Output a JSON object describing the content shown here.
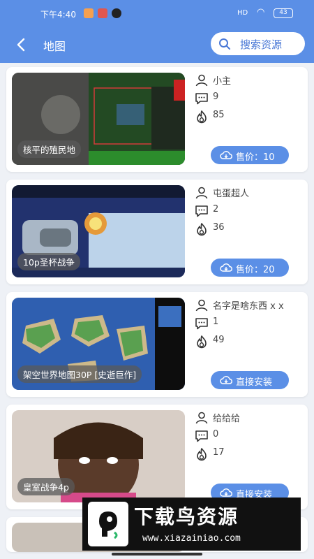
{
  "status_bar": {
    "time": "下午4:40",
    "signal": "HD",
    "battery": "43"
  },
  "header": {
    "title": "地图",
    "search_label": "搜索资源"
  },
  "cards": [
    {
      "name": "核平的殖民地",
      "author": "小主",
      "comments": "9",
      "hot": "85",
      "action": "售价：10"
    },
    {
      "name": "10p圣杯战争",
      "author": "屯蛋超人",
      "comments": "2",
      "hot": "36",
      "action": "售价：20"
    },
    {
      "name": "架空世界地图30P [史逝巨作]",
      "author": "名字是啥东西 x x",
      "comments": "1",
      "hot": "49",
      "action": "直接安装"
    },
    {
      "name": "皇室战争4p",
      "author": "给给给",
      "comments": "0",
      "hot": "17",
      "action": "直接安装"
    }
  ],
  "watermark": {
    "brand": "下载鸟资源",
    "url": "www.xiazainiao.com"
  },
  "colors": {
    "primary": "#5b8fe6",
    "background": "#eef1f6"
  }
}
